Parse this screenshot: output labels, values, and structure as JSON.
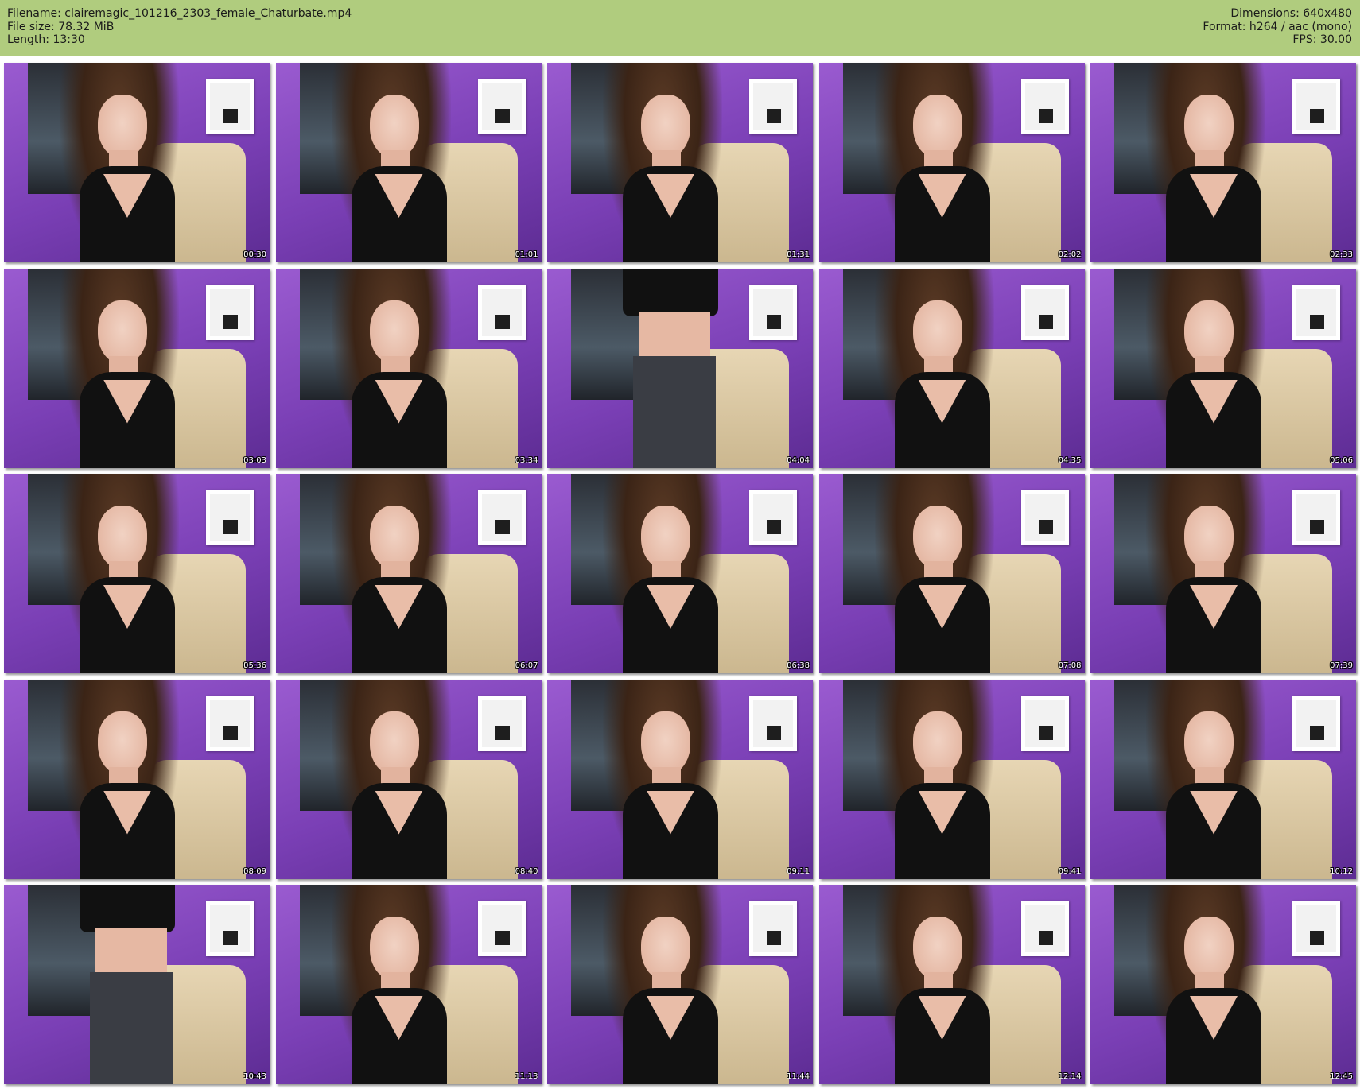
{
  "header": {
    "filename": "Filename: clairemagic_101216_2303_female_Chaturbate.mp4",
    "filesize": "File size: 78.32 MiB",
    "length": "Length: 13:30",
    "dimensions": "Dimensions: 640x480",
    "format": "Format: h264 / aac (mono)",
    "fps": "FPS: 30.00",
    "background_color": "#b0cc7e"
  },
  "thumbnails": [
    {
      "timestamp": "00:30",
      "variant": "portrait"
    },
    {
      "timestamp": "01:01",
      "variant": "portrait"
    },
    {
      "timestamp": "01:31",
      "variant": "portrait"
    },
    {
      "timestamp": "02:02",
      "variant": "portrait"
    },
    {
      "timestamp": "02:33",
      "variant": "portrait"
    },
    {
      "timestamp": "03:03",
      "variant": "portrait"
    },
    {
      "timestamp": "03:34",
      "variant": "portrait"
    },
    {
      "timestamp": "04:04",
      "variant": "body"
    },
    {
      "timestamp": "04:35",
      "variant": "portrait"
    },
    {
      "timestamp": "05:06",
      "variant": "portrait"
    },
    {
      "timestamp": "05:36",
      "variant": "portrait"
    },
    {
      "timestamp": "06:07",
      "variant": "portrait"
    },
    {
      "timestamp": "06:38",
      "variant": "portrait"
    },
    {
      "timestamp": "07:08",
      "variant": "portrait"
    },
    {
      "timestamp": "07:39",
      "variant": "portrait"
    },
    {
      "timestamp": "08:09",
      "variant": "portrait"
    },
    {
      "timestamp": "08:40",
      "variant": "portrait"
    },
    {
      "timestamp": "09:11",
      "variant": "portrait"
    },
    {
      "timestamp": "09:41",
      "variant": "portrait"
    },
    {
      "timestamp": "10:12",
      "variant": "portrait"
    },
    {
      "timestamp": "10:43",
      "variant": "body"
    },
    {
      "timestamp": "11:13",
      "variant": "portrait"
    },
    {
      "timestamp": "11:44",
      "variant": "portrait"
    },
    {
      "timestamp": "12:14",
      "variant": "portrait"
    },
    {
      "timestamp": "12:45",
      "variant": "portrait"
    }
  ]
}
